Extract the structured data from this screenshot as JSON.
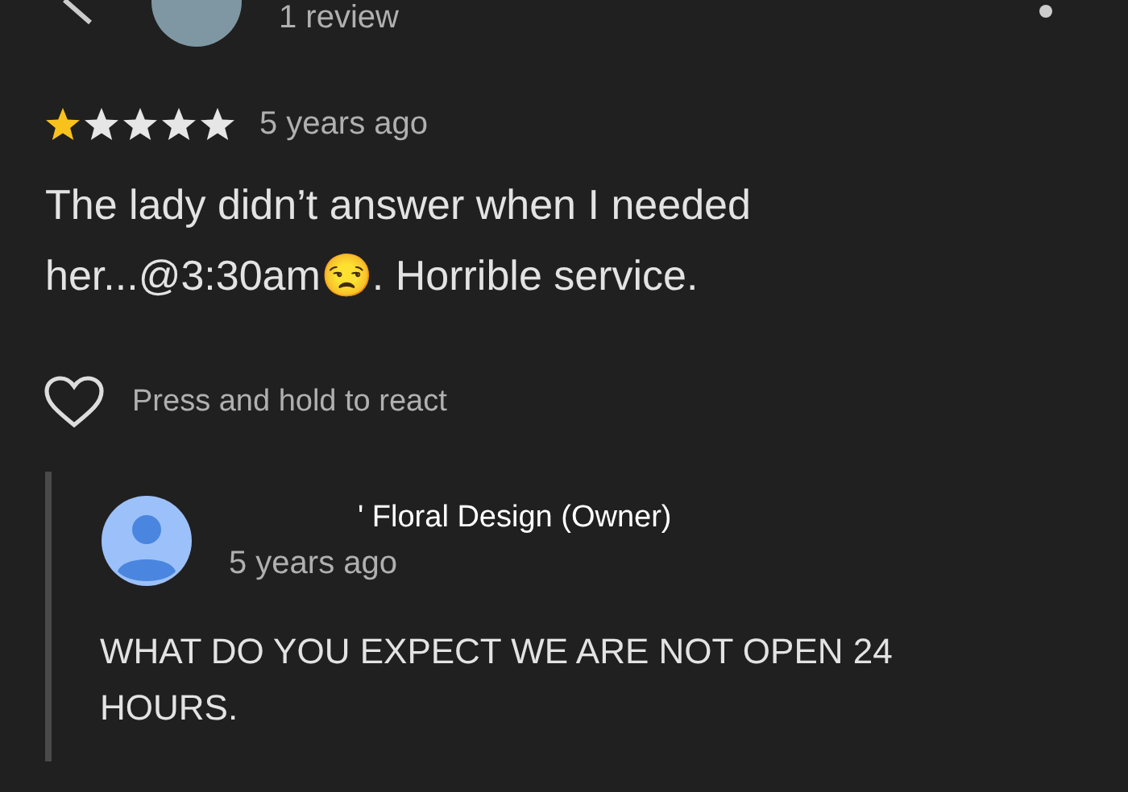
{
  "reviewer": {
    "review_count": "1 review"
  },
  "review": {
    "stars": 1,
    "time": "5 years ago",
    "text": "The lady didn’t answer when I needed her...@3:30am😒. Horrible service."
  },
  "react": {
    "label": "Press and hold to react"
  },
  "owner_reply": {
    "name": "' Floral Design (Owner)",
    "time": "5 years ago",
    "text": "WHAT DO YOU EXPECT WE ARE NOT OPEN 24 HOURS."
  }
}
